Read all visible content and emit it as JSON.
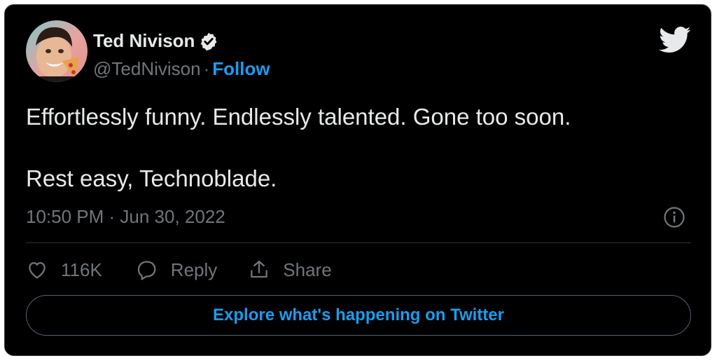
{
  "author": {
    "display_name": "Ted Nivison",
    "handle": "@TedNivison",
    "separator": "·",
    "follow_label": "Follow",
    "verified": true,
    "avatar": "avatar-photo"
  },
  "brand": {
    "icon": "twitter-bird-icon",
    "accent_color": "#1d9bf0"
  },
  "tweet": {
    "lines": [
      "Effortlessly funny. Endlessly talented. Gone too soon.",
      "Rest easy, Technoblade."
    ],
    "timestamp": "10:50 PM · Jun 30, 2022"
  },
  "actions": {
    "like_count": "116K",
    "reply_label": "Reply",
    "share_label": "Share"
  },
  "explore_label": "Explore what's happening on Twitter"
}
